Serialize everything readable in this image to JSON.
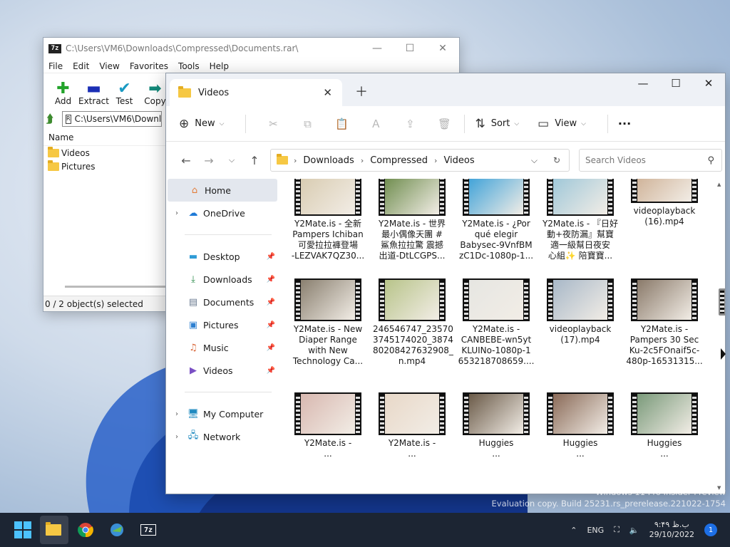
{
  "sevenzip": {
    "title": "C:\\Users\\VM6\\Downloads\\Compressed\\Documents.rar\\",
    "logo": "7z",
    "menu": [
      "File",
      "Edit",
      "View",
      "Favorites",
      "Tools",
      "Help"
    ],
    "toolbar": [
      {
        "label": "Add",
        "icon": "plus-icon",
        "color": "#22a32a"
      },
      {
        "label": "Extract",
        "icon": "minus-icon",
        "color": "#1b2fb5"
      },
      {
        "label": "Test",
        "icon": "check-icon",
        "color": "#1a9ac2"
      },
      {
        "label": "Copy",
        "icon": "arrow-right-icon",
        "color": "#138a7a"
      }
    ],
    "address": "C:\\Users\\VM6\\Downloads\\Compressed\\Documents.rar\\",
    "column_name": "Name",
    "items": [
      "Videos",
      "Pictures"
    ],
    "status": "0 / 2 object(s) selected"
  },
  "explorer": {
    "tab_title": "Videos",
    "commands": {
      "new": "New",
      "sort": "Sort",
      "view": "View",
      "more": "···"
    },
    "breadcrumb": [
      "Downloads",
      "Compressed",
      "Videos"
    ],
    "search_placeholder": "Search Videos",
    "sidebar": {
      "home": "Home",
      "onedrive": "OneDrive",
      "quick": [
        {
          "label": "Desktop",
          "icon": "desktop-icon",
          "color": "#2f9bd6"
        },
        {
          "label": "Downloads",
          "icon": "download-icon",
          "color": "#2a8a4a"
        },
        {
          "label": "Documents",
          "icon": "document-icon",
          "color": "#6a7a90"
        },
        {
          "label": "Pictures",
          "icon": "pictures-icon",
          "color": "#2c7fd1"
        },
        {
          "label": "Music",
          "icon": "music-icon",
          "color": "#d9673a"
        },
        {
          "label": "Videos",
          "icon": "videos-icon",
          "color": "#7a4fc4"
        }
      ],
      "my_computer": "My Computer",
      "network": "Network"
    },
    "files": [
      {
        "caption": "Y2Mate.is - 全新\nPampers Ichiban\n可愛拉拉褲登場\n-LEZVAK7QZ30...",
        "tint": "#d8cbb0"
      },
      {
        "caption": "Y2Mate.is - 世界\n最小偶像天團 #\n鯊魚拉拉驚 震撼\n出道-DtLCGPS...",
        "tint": "#6b8a4a"
      },
      {
        "caption": "Y2Mate.is - ¿Por\nqué elegir\nBabysec-9VnfBM\nzC1Dc-1080p-1...",
        "tint": "#3aa0d8"
      },
      {
        "caption": "Y2Mate.is - 『日好\n動+夜防漏』幫寶\n適一級幫日夜安\n心組✨ 陪寶寶...",
        "tint": "#9cc6d8"
      },
      {
        "caption": "videoplayback\n(16).mp4",
        "tint": "#c9a88a"
      },
      {
        "caption": "Y2Mate.is - New\nDiaper Range\nwith New\nTechnology  Ca...",
        "tint": "#8a8070"
      },
      {
        "caption": "246546747_23570\n3745174020_3874\n80208427632908_\nn.mp4",
        "tint": "#b8c48a"
      },
      {
        "caption": "Y2Mate.is -\nCANBEBE-wn5yt\nKLUINo-1080p-1\n653218708659....",
        "tint": "#e6e6e2"
      },
      {
        "caption": "videoplayback\n(17).mp4",
        "tint": "#a8b8c8"
      },
      {
        "caption": "Y2Mate.is -\nPampers 30 Sec\nKu-2c5FOnaif5c-\n480p-16531315...",
        "tint": "#8a7a6a"
      },
      {
        "caption": "Y2Mate.is -\n...",
        "tint": "#d8b8b0"
      },
      {
        "caption": "Y2Mate.is -\n...",
        "tint": "#e8d8c8"
      },
      {
        "caption": "Huggies\n...",
        "tint": "#6a5a48"
      },
      {
        "caption": "Huggies\n...",
        "tint": "#8a6a58"
      },
      {
        "caption": "Huggies\n...",
        "tint": "#7a9a7a"
      }
    ]
  },
  "taskbar": {
    "tray_lang": "ENG",
    "time": "۹:۴۹ ب.ظ",
    "date": "29/10/2022",
    "notifications": "1"
  },
  "watermark": {
    "line1": "Windows 11 Pro Insider Preview",
    "line2": "Evaluation copy. Build 25231.rs_prerelease.221022-1754"
  }
}
